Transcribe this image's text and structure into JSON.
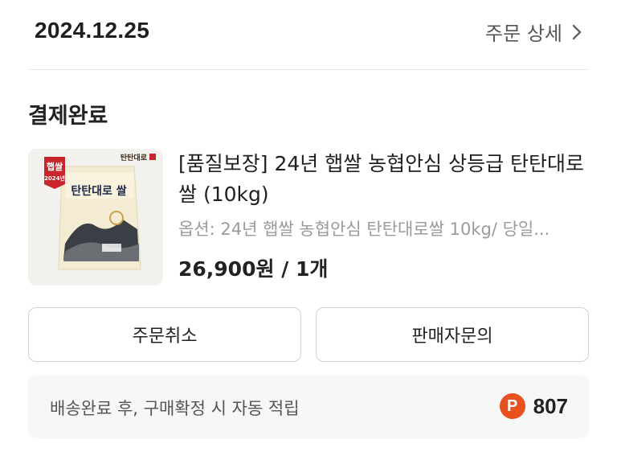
{
  "order": {
    "date": "2024.12.25",
    "detail_link_label": "주문 상세"
  },
  "status": {
    "label": "결제완료"
  },
  "product": {
    "title": "[품질보장] 24년 햅쌀 농협안심 상등급 탄탄대로쌀 (10kg)",
    "option": "옵션: 24년 햅쌀 농협안심 탄탄대로쌀 10kg/ 당일...",
    "price_quantity": "26,900원 / 1개",
    "thumbnail": {
      "badge_line1": "햅쌀",
      "badge_line2": "2024년",
      "brand": "탄탄대로",
      "bag_label": "탄탄대로 쌀"
    }
  },
  "actions": {
    "cancel_label": "주문취소",
    "inquiry_label": "판매자문의"
  },
  "points": {
    "description": "배송완료 후, 구매확정 시 자동 적립",
    "icon_letter": "P",
    "amount": "807"
  },
  "colors": {
    "points_icon": "#e8501f",
    "badge_red": "#c8262c",
    "divider": "#e9e9e9"
  },
  "icons": {
    "detail": "chevron-right-icon",
    "points": "points-p-icon"
  }
}
